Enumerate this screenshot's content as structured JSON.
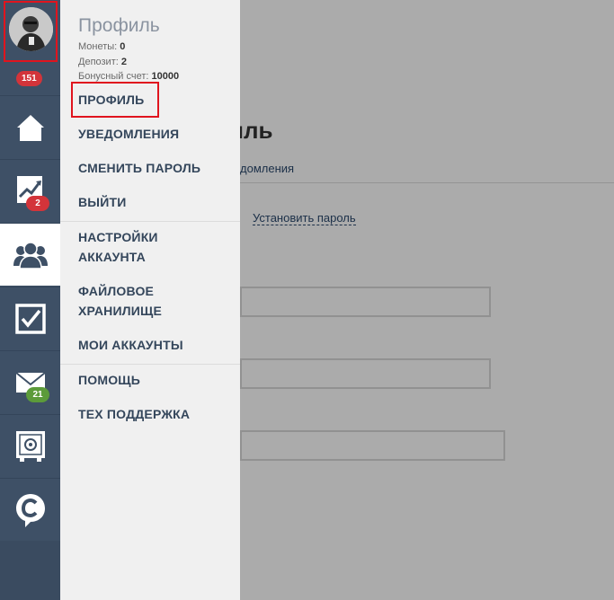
{
  "background": {
    "title": "иль",
    "tab": "домления",
    "link": "Установить пароль"
  },
  "rail": {
    "avatar_badge": "151",
    "items": [
      {
        "icon": "home-icon"
      },
      {
        "icon": "chart-icon",
        "badge": "2"
      },
      {
        "icon": "users-icon"
      },
      {
        "icon": "checkbox-icon"
      },
      {
        "icon": "mail-icon",
        "badge": "21"
      },
      {
        "icon": "safe-icon"
      },
      {
        "icon": "chat-c-icon"
      }
    ]
  },
  "panel": {
    "title": "Профиль",
    "stats": [
      {
        "label": "Монеты:",
        "value": "0"
      },
      {
        "label": "Депозит:",
        "value": "2"
      },
      {
        "label": "Бонусный счет:",
        "value": "10000"
      }
    ],
    "menu": [
      "ПРОФИЛЬ",
      "УВЕДОМЛЕНИЯ",
      "СМЕНИТЬ ПАРОЛЬ",
      "ВЫЙТИ",
      "НАСТРОЙКИ",
      "АККАУНТА",
      "ФАЙЛОВОЕ",
      "ХРАНИЛИЩЕ",
      "МОИ АККАУНТЫ",
      "ПОМОЩЬ",
      "ТЕХ ПОДДЕРЖКА"
    ]
  },
  "colors": {
    "rail": "#3e5066",
    "panel": "#f0f0f0",
    "badge_red": "#d3343a",
    "badge_green": "#5c9b3a",
    "highlight": "#e0141e"
  }
}
